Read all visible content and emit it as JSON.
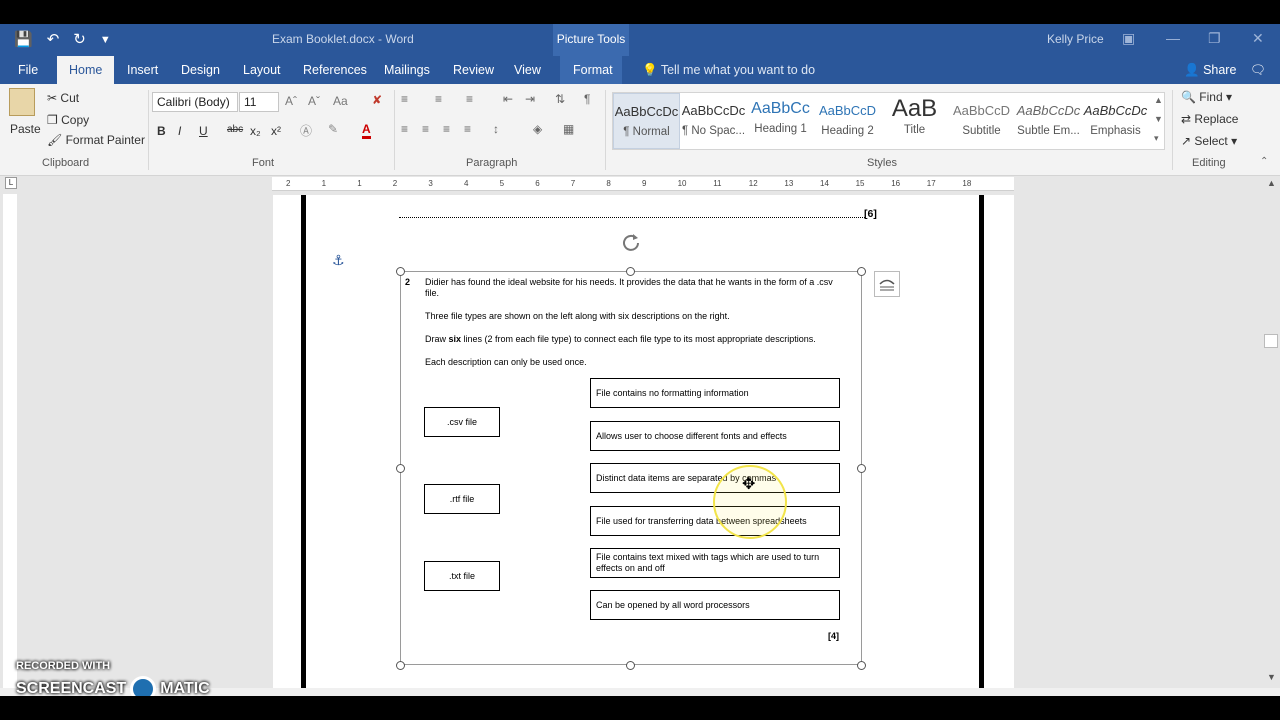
{
  "window": {
    "title": "Exam Booklet.docx  -  Word",
    "context_tab_group": "Picture Tools",
    "user": "Kelly Price"
  },
  "tabs": [
    "File",
    "Home",
    "Insert",
    "Design",
    "Layout",
    "References",
    "Mailings",
    "Review",
    "View",
    "Format"
  ],
  "active_tab": "Home",
  "tell_me": "Tell me what you want to do",
  "share": "Share",
  "clipboard": {
    "paste": "Paste",
    "cut": "Cut",
    "copy": "Copy",
    "format_painter": "Format Painter",
    "label": "Clipboard"
  },
  "font": {
    "name": "Calibri (Body)",
    "size": "11",
    "label": "Font",
    "buttons": [
      "B",
      "I",
      "U",
      "abc",
      "x₂",
      "x²"
    ]
  },
  "paragraph": {
    "label": "Paragraph"
  },
  "styles": {
    "label": "Styles",
    "items": [
      {
        "preview": "AaBbCcDc",
        "name": "¶ Normal"
      },
      {
        "preview": "AaBbCcDc",
        "name": "¶ No Spac..."
      },
      {
        "preview": "AaBbCc",
        "name": "Heading 1"
      },
      {
        "preview": "AaBbCcD",
        "name": "Heading 2"
      },
      {
        "preview": "AaB",
        "name": "Title"
      },
      {
        "preview": "AaBbCcD",
        "name": "Subtitle"
      },
      {
        "preview": "AaBbCcDc",
        "name": "Subtle Em..."
      },
      {
        "preview": "AaBbCcDc",
        "name": "Emphasis"
      }
    ]
  },
  "editing": {
    "find": "Find",
    "replace": "Replace",
    "select": "Select",
    "label": "Editing"
  },
  "ruler_numbers": [
    "2",
    "1",
    "1",
    "2",
    "3",
    "4",
    "5",
    "6",
    "7",
    "8",
    "9",
    "10",
    "11",
    "12",
    "13",
    "14",
    "15",
    "16",
    "17",
    "18"
  ],
  "document": {
    "marks_top": "[6]",
    "question_number": "2",
    "lines": [
      "Didier has found the ideal website for his needs. It provides the data that he wants in the form of a .csv file.",
      "Three file types are shown on the left along with six descriptions on the right.",
      "Each description can only be used once."
    ],
    "instruction_pre": "Draw ",
    "instruction_bold": "six",
    "instruction_post": " lines (2 from each file type) to connect each file type to its most appropriate descriptions.",
    "file_types": [
      ".csv file",
      ".rtf file",
      ".txt file"
    ],
    "descriptions": [
      "File contains no formatting information",
      "Allows user to choose different fonts and effects",
      "Distinct data items are separated by commas",
      "File used for transferring data between spreadsheets",
      "File contains text mixed with tags which are used to turn effects on and off",
      "Can be opened by all word processors"
    ],
    "marks_bottom": "[4]"
  },
  "watermark": {
    "line1": "RECORDED WITH",
    "line2": "SCREENCAST",
    "line3": "MATIC"
  }
}
